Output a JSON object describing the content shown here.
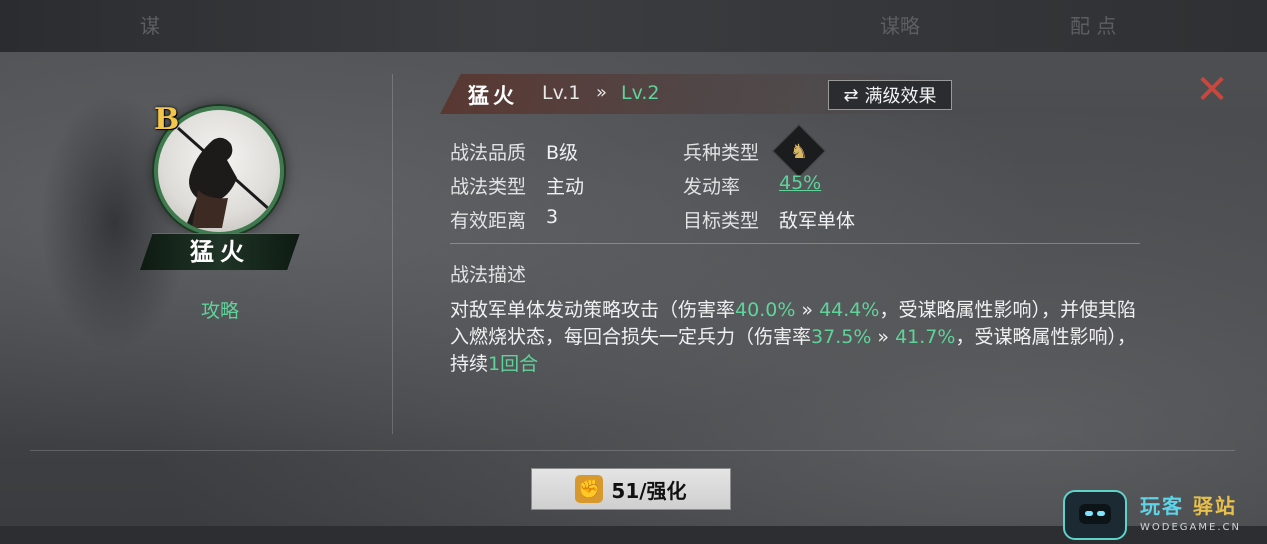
{
  "topbar": {
    "ghost_left": "谋",
    "ghost_mid": "谋略",
    "ghost_right": "配 点"
  },
  "hero": {
    "grade": "B",
    "name": "猛火",
    "guide_label": "攻略"
  },
  "skill": {
    "name": "猛火",
    "level_current": "Lv.1",
    "level_arrow": "»",
    "level_next": "Lv.2",
    "max_effect_label": "满级效果",
    "info": {
      "quality_label": "战法品质",
      "quality_value": "B级",
      "type_label": "战法类型",
      "type_value": "主动",
      "range_label": "有效距离",
      "range_value": "3",
      "unit_label": "兵种类型",
      "unit_icon": "horse-icon",
      "rate_label": "发动率",
      "rate_value": "45%",
      "target_label": "目标类型",
      "target_value": "敌军单体"
    },
    "description_title": "战法描述",
    "description": {
      "p1": "对敌军单体发动策略攻击（伤害率",
      "v1": "40.0%",
      "a1": " » ",
      "v2": "44.4%",
      "p2": "，受谋略属性影响），并使其陷入燃烧状态，每回合损失一定兵力（伤害率",
      "v3": "37.5%",
      "a2": " » ",
      "v4": "41.7%",
      "p3": "，受谋略属性影响），持续",
      "v5": "1回合"
    }
  },
  "enhance_button": {
    "label": "51/强化"
  },
  "watermark": {
    "main_a": "玩客",
    "main_b": "驿站",
    "sub": "WODEGAME.CN"
  },
  "colors": {
    "accent_green": "#5fd39a",
    "close_red": "#c9473c",
    "grade_gold": "#f2c64a"
  }
}
